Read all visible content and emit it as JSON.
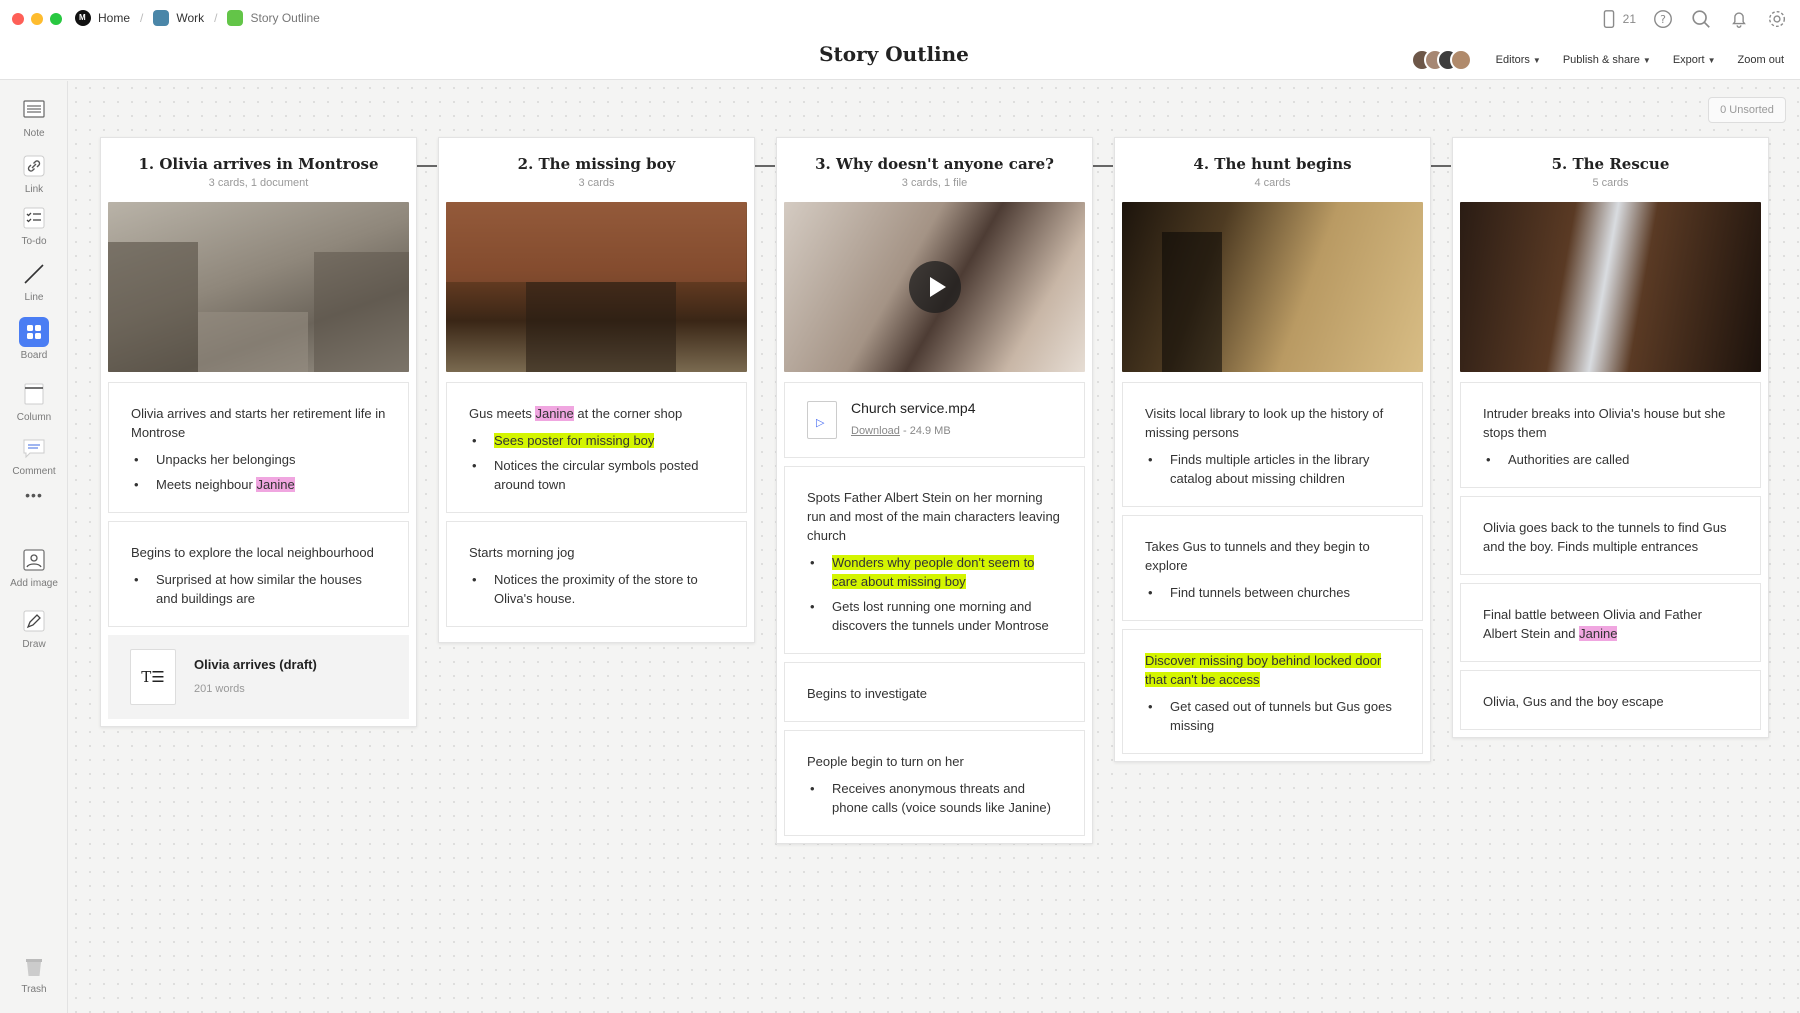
{
  "breadcrumbs": [
    {
      "label": "Home",
      "color": "#111111"
    },
    {
      "label": "Work",
      "color": "#4a86a8"
    },
    {
      "label": "Story Outline",
      "color": "#63c548"
    }
  ],
  "page_title": "Story Outline",
  "top_icons": {
    "device_count": "21"
  },
  "toolbar": {
    "editors": "Editors",
    "publish": "Publish & share",
    "export": "Export",
    "zoom": "Zoom out"
  },
  "sidebar": {
    "note": "Note",
    "link": "Link",
    "todo": "To-do",
    "line": "Line",
    "board": "Board",
    "column": "Column",
    "comment": "Comment",
    "more": "•••",
    "add_image": "Add image",
    "draw": "Draw",
    "trash": "Trash"
  },
  "unsorted": "0 Unsorted",
  "columns": [
    {
      "title": "1. Olivia arrives in Montrose",
      "subtitle": "3 cards, 1 document",
      "cards": [
        {
          "text": "Olivia arrives and starts her retirement life in Montrose",
          "bullets": [
            "Unpacks her belongings",
            "Meets neighbour "
          ],
          "highlight": "Janine"
        },
        {
          "text": "Begins to explore the local neighbourhood",
          "bullets": [
            "Surprised at how similar the houses and buildings are"
          ]
        }
      ],
      "document": {
        "icon_text": "T☰",
        "title": "Olivia arrives (draft)",
        "words": "201 words"
      }
    },
    {
      "title": "2. The missing boy",
      "subtitle": "3 cards",
      "cards": [
        {
          "text_pre": "Gus meets ",
          "highlight": "Janine",
          "text_post": " at the corner shop",
          "bullets": [
            "Sees poster for missing boy",
            "Notices the circular symbols posted around town"
          ]
        },
        {
          "text": "Starts morning jog",
          "bullets": [
            "Notices the proximity of the store to Oliva's house."
          ]
        }
      ]
    },
    {
      "title": "3. Why doesn't anyone care?",
      "subtitle": "3 cards, 1 file",
      "file": {
        "name": "Church service.mp4",
        "download": "Download",
        "size": " - 24.9 MB"
      },
      "cards": [
        {
          "text": "Spots Father Albert Stein on her morning run and most of the main characters leaving church",
          "bullets": [
            "Wonders why people don't seem to care about missing boy",
            "Gets lost running one morning and discovers the tunnels under Montrose"
          ]
        },
        {
          "text": "Begins to investigate"
        },
        {
          "text": "People begin to turn on her",
          "bullets": [
            "Receives anonymous threats and phone calls (voice sounds like Janine)"
          ]
        }
      ]
    },
    {
      "title": "4. The hunt begins",
      "subtitle": "4 cards",
      "cards": [
        {
          "text": "Visits local library to look up the history of missing persons",
          "bullets": [
            "Finds multiple articles in the library catalog about missing children"
          ]
        },
        {
          "text": "Takes Gus to tunnels and they begin to explore",
          "bullets": [
            "Find tunnels between churches"
          ]
        },
        {
          "text": "Discover missing boy behind locked door that can't be access",
          "bullets": [
            "Get cased out of tunnels but Gus goes missing"
          ]
        }
      ]
    },
    {
      "title": "5. The Rescue",
      "subtitle": "5 cards",
      "cards": [
        {
          "text": "Intruder breaks into Olivia's house but she stops them",
          "bullets": [
            "Authorities are called"
          ]
        },
        {
          "text": "Olivia goes back to the tunnels to find Gus and the boy. Finds multiple entrances"
        },
        {
          "text_pre": "Final battle between Olivia and Father Albert Stein and ",
          "highlight": "Janine"
        },
        {
          "text": "Olivia, Gus and the boy escape"
        }
      ]
    }
  ],
  "colors": {
    "highlight_pink": "#f0a6e0",
    "highlight_green": "#d4f500",
    "board_accent": "#4a7df3"
  }
}
